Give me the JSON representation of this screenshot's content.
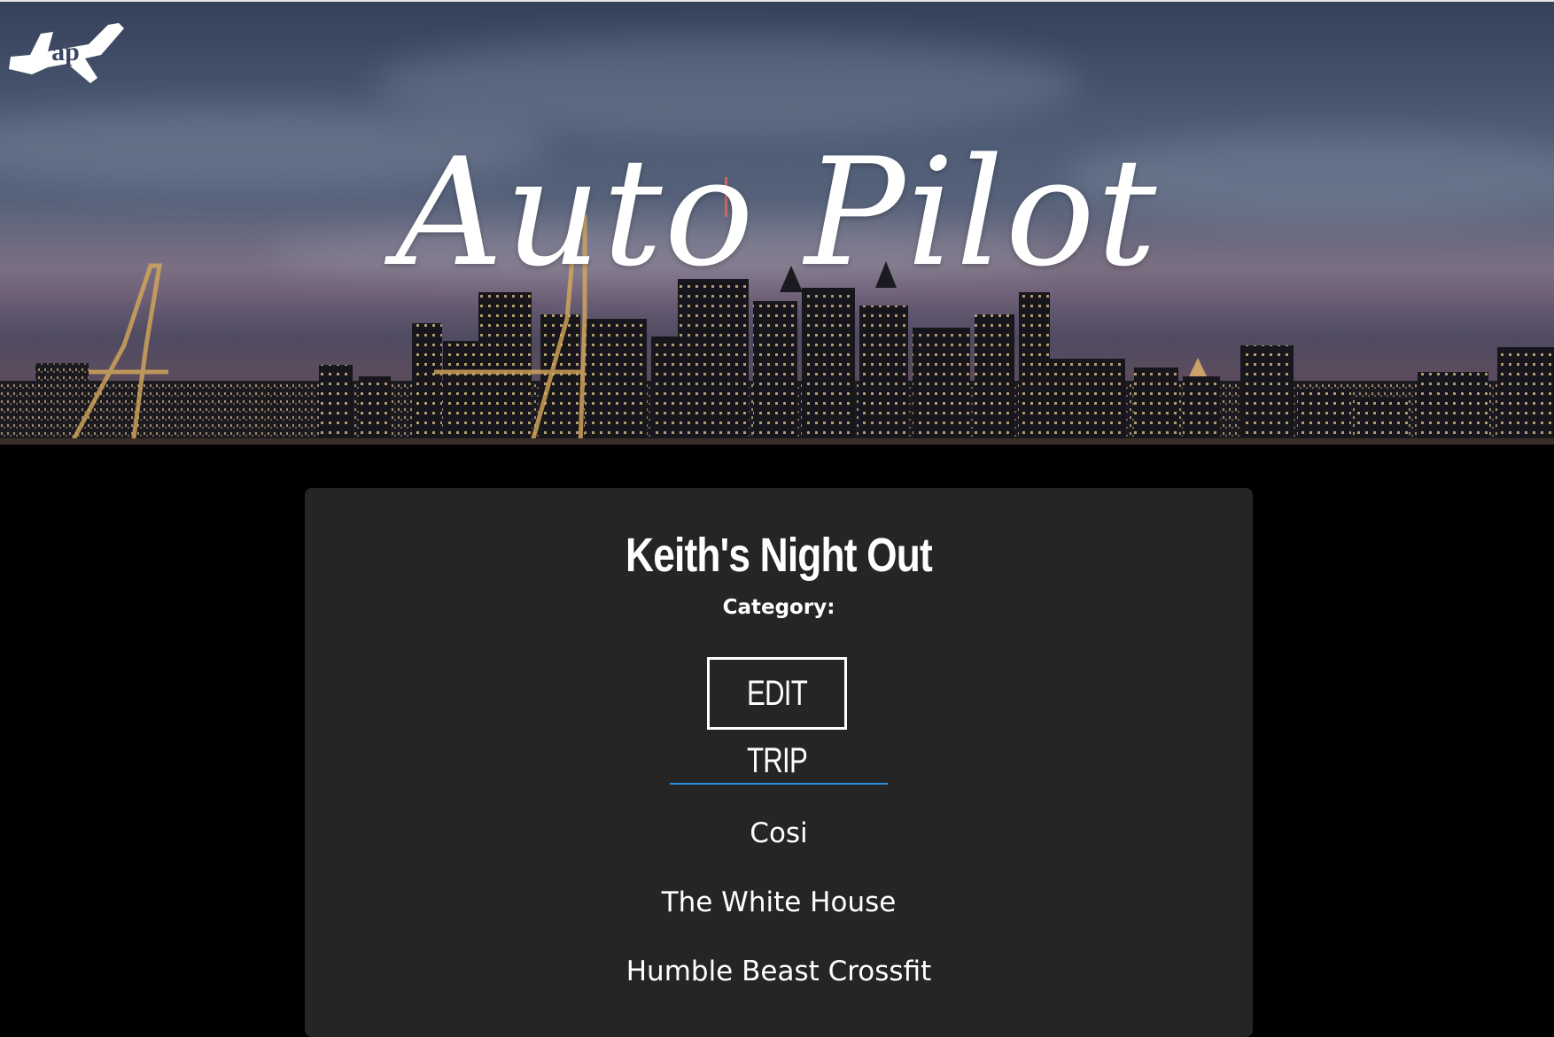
{
  "header": {
    "logo_text": "ap",
    "title": "Auto Pilot"
  },
  "trip": {
    "name": "Keith's Night Out",
    "category_label": "Category:",
    "edit_label": "EDIT TRIP",
    "stops": [
      "Cosi",
      "The White House",
      "Humble Beast Crossfit"
    ]
  },
  "colors": {
    "page_background": "#000000",
    "card_background": "#252525",
    "divider_accent": "#2b8fe0",
    "text": "#ffffff"
  },
  "icons": {
    "logo": "airplane-icon"
  }
}
